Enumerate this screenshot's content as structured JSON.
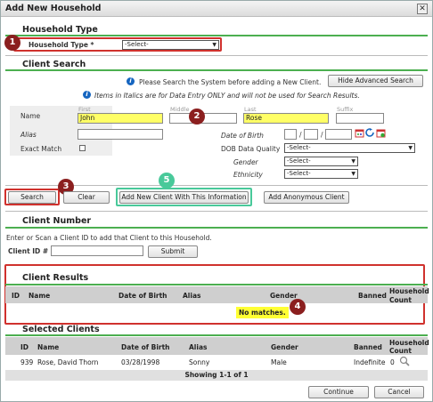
{
  "window": {
    "title": "Add New Household",
    "close_glyph": "✕"
  },
  "household_type": {
    "section_title": "Household Type",
    "label": "Household Type *",
    "value": "-Select-"
  },
  "client_search": {
    "section_title": "Client Search",
    "notice1": "Please Search the System before adding a New Client.",
    "hide_button": "Hide Advanced Search",
    "notice2": "Items in Italics are for Data Entry ONLY and will not be used for Search Results.",
    "name_label": "Name",
    "first_label": "First",
    "middle_label": "Middle",
    "last_label": "Last",
    "suffix_label": "Suffix",
    "first_value": "John",
    "middle_value": "",
    "last_value": "Rose",
    "suffix_value": "",
    "alias_label": "Alias",
    "exact_match_label": "Exact Match",
    "dob_label": "Date of Birth",
    "dob_quality_label": "DOB Data Quality",
    "gender_label": "Gender",
    "ethnicity_label": "Ethnicity",
    "dob_quality_value": "-Select-",
    "gender_value": "-Select-",
    "ethnicity_value": "-Select-",
    "date_sep": "/"
  },
  "action_buttons": {
    "search": "Search",
    "clear": "Clear",
    "add_new": "Add New Client With This Information",
    "add_anonymous": "Add Anonymous Client"
  },
  "client_number": {
    "section_title": "Client Number",
    "instruction": "Enter or Scan a Client ID to add that Client to this Household.",
    "id_label": "Client ID #",
    "submit": "Submit"
  },
  "client_results": {
    "section_title": "Client Results",
    "columns": [
      "ID",
      "Name",
      "Date of Birth",
      "Alias",
      "Gender",
      "Banned",
      "Household",
      "Count"
    ],
    "no_matches": "No matches."
  },
  "selected_clients": {
    "section_title": "Selected Clients",
    "columns": [
      "ID",
      "Name",
      "Date of Birth",
      "Alias",
      "Gender",
      "Banned",
      "Household",
      "Count"
    ],
    "row": {
      "id": "939",
      "name": "Rose, David Thorn",
      "dob": "03/28/1998",
      "alias": "Sonny",
      "gender": "Male",
      "banned": "Indefinite",
      "count": "0"
    },
    "showing": "Showing 1-1 of 1"
  },
  "footer": {
    "continue": "Continue",
    "cancel": "Cancel"
  },
  "callouts": {
    "b1": "1",
    "b2": "2",
    "b3": "3",
    "b4": "4",
    "b5": "5"
  }
}
